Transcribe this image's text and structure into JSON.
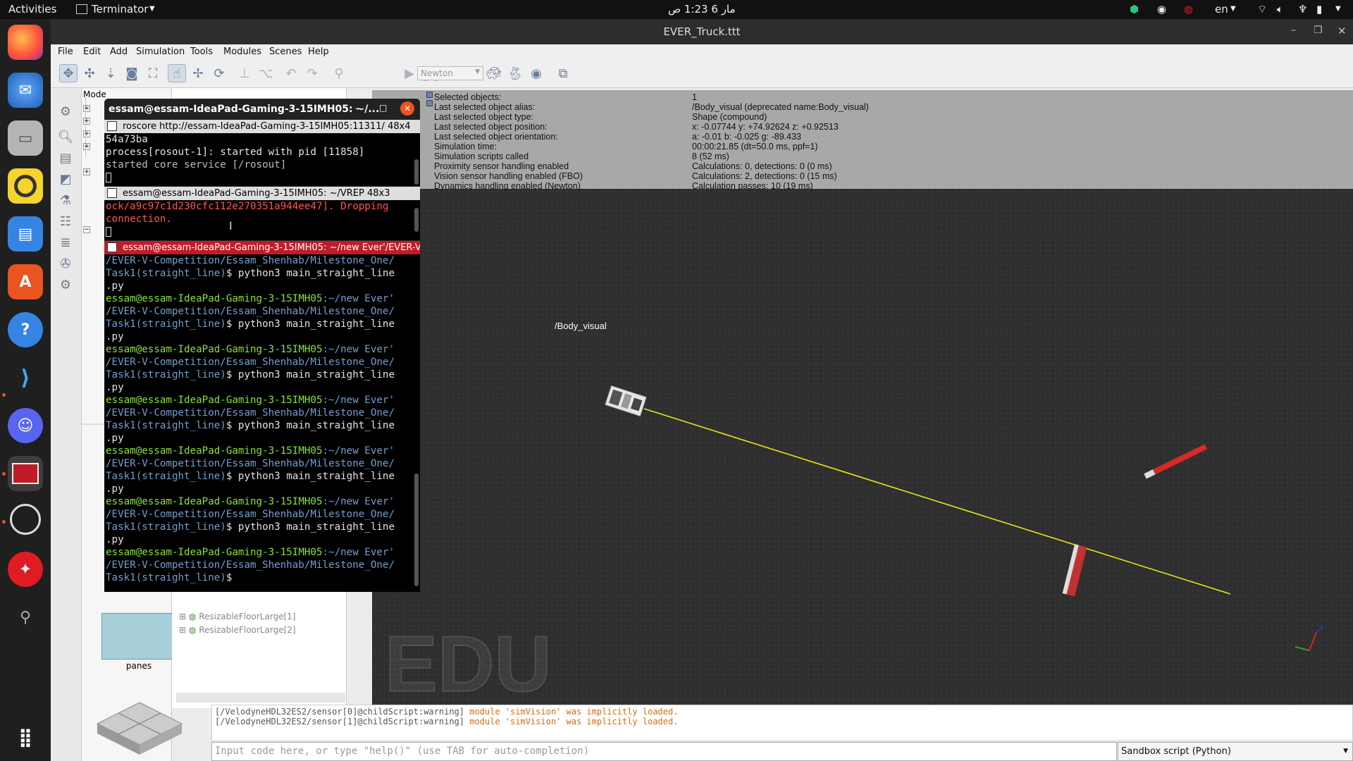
{
  "topbar": {
    "activities": "Activities",
    "app_name": "Terminator",
    "clock": "مار 6  1:23 ص",
    "keyboard_layout": "en"
  },
  "dock": {
    "items": [
      "firefox-icon",
      "thunderbird-icon",
      "files-icon",
      "rhythmbox-icon",
      "writer-icon",
      "software-center-icon",
      "help-icon",
      "vscode-icon",
      "discord-icon",
      "terminator-icon",
      "obs-icon",
      "yoga-icon",
      "usb-icon"
    ],
    "grid_label": "show-apps-icon"
  },
  "coppelia": {
    "window_title": "EVER_Truck.ttt",
    "menu": [
      "File",
      "Edit",
      "Add",
      "Simulation",
      "Tools",
      "Modules",
      "Scenes",
      "Help"
    ],
    "engine": "Newton",
    "model_browser_label": "Mode",
    "model_preview_label": "panes",
    "hierarchy_items": [
      "ResizableFloorLarge[1]",
      "ResizableFloorLarge[2]"
    ],
    "info": [
      {
        "label": "Selected objects:",
        "value": "1"
      },
      {
        "label": "Last selected object alias:",
        "value": "/Body_visual    (deprecated name:Body_visual)"
      },
      {
        "label": "Last selected object type:",
        "value": "Shape (compound)"
      },
      {
        "label": "Last selected object position:",
        "value": "x: -0.07744    y: +74.92624    z: +0.92513"
      },
      {
        "label": "Last selected object orientation:",
        "value": "a: -0.01    b: -0.025    g: -89.433"
      },
      {
        "label": "Simulation time:",
        "value": "00:00:21.85 (dt=50.0 ms, ppf=1)"
      },
      {
        "label": "Simulation scripts called",
        "value": "8 (52 ms)"
      },
      {
        "label": "Proximity sensor handling enabled",
        "value": "Calculations: 0, detections: 0 (0 ms)"
      },
      {
        "label": "Vision sensor handling enabled (FBO)",
        "value": "Calculations: 2, detections: 0 (15 ms)"
      },
      {
        "label": "Dynamics handling enabled (Newton)",
        "value": "Calculation passes: 10 (19 ms)"
      }
    ],
    "object_label": "/Body_visual",
    "watermark": "EDU",
    "console": [
      {
        "prefix": "[/VelodyneHDL32ES2/sensor[0]@childScript:warning] ",
        "msg": "module 'simVision' was implicitly loaded."
      },
      {
        "prefix": "[/VelodyneHDL32ES2/sensor[1]@childScript:warning] ",
        "msg": "module 'simVision' was implicitly loaded."
      }
    ],
    "command_placeholder": "Input code here, or type \"help()\" (use TAB for auto-completion)",
    "sandbox": "Sandbox script (Python)"
  },
  "terminal": {
    "title": "essam@essam-IdeaPad-Gaming-3-15IMH05: ~/...",
    "pane1": {
      "header": "roscore http://essam-IdeaPad-Gaming-3-15IMH05:11311/ 48x4",
      "lines": [
        "54a73ba",
        "process[rosout-1]: started with pid [11858]",
        "started core service [/rosout]"
      ]
    },
    "pane2": {
      "header": "essam@essam-IdeaPad-Gaming-3-15IMH05: ~/VREP 48x3",
      "lines": [
        "ock/a9c97c1d230cfc112e270351a944ee47]. Dropping",
        "connection."
      ]
    },
    "pane3": {
      "header": "essam@essam-IdeaPad-Gaming-3-15IMH05: ~/new Ever'/EVER-V",
      "first_lines": [
        "/EVER-V-Competition/Essam_Shenhab/Milestone_One/",
        "Task1(straight_line)$ python3 main_straight_line",
        ".py"
      ],
      "prompt_user": "essam@essam-IdeaPad-Gaming-3-15IMH05",
      "prompt_path1": ":~/new Ever'",
      "prompt_path2": "/EVER-V-Competition/Essam_Shenhab/Milestone_One/",
      "prompt_path3": "Task1(straight_line)",
      "command": "$ python3 main_straight_line",
      "command_cont": ".py",
      "last_prompt_end": "$ "
    }
  }
}
